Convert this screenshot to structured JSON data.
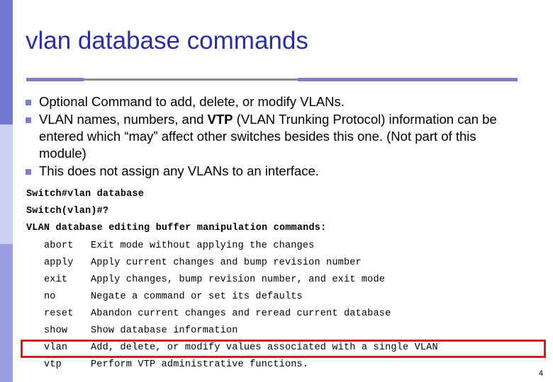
{
  "slide": {
    "title": "vlan database commands",
    "page_number": "4",
    "colors": {
      "title": "#2b2f9e",
      "bullet_marker": "#7b7fcc",
      "strip_top": "#7478d2",
      "strip_mid": "#cdd0f0",
      "strip_bottom": "#9a9de4",
      "divider_purple": "#7b7fc6",
      "divider_gray": "#8a8a93",
      "highlight_red": "#cc2027",
      "background": "#ffffff"
    }
  },
  "bullets": [
    {
      "marker": "square-bullet",
      "parts": [
        {
          "text": "Optional Command to add, delete, or modify VLANs.",
          "bold": false
        }
      ]
    },
    {
      "marker": "square-bullet",
      "parts": [
        {
          "text": "VLAN names, numbers, and ",
          "bold": false
        },
        {
          "text": "VTP",
          "bold": true
        },
        {
          "text": " (VLAN Trunking Protocol) information can be entered which “may” affect other switches besides this one.  (Not part of this module)",
          "bold": false
        }
      ]
    },
    {
      "marker": "square-bullet",
      "parts": [
        {
          "text": "This does not assign any VLANs to an interface.",
          "bold": false
        }
      ]
    }
  ],
  "console": {
    "lines": [
      "Switch#vlan database",
      "Switch(vlan)#?",
      "VLAN database editing buffer manipulation commands:"
    ]
  },
  "commands": [
    {
      "name": "abort",
      "description": "Exit mode without applying the changes",
      "highlighted": false
    },
    {
      "name": "apply",
      "description": "Apply current changes and bump revision number",
      "highlighted": false
    },
    {
      "name": "exit",
      "description": "Apply changes, bump revision number, and exit mode",
      "highlighted": false
    },
    {
      "name": "no",
      "description": "Negate a command or set its defaults",
      "highlighted": false
    },
    {
      "name": "reset",
      "description": "Abandon current changes and reread current database",
      "highlighted": false
    },
    {
      "name": "show",
      "description": "Show database information",
      "highlighted": false
    },
    {
      "name": "vlan",
      "description": "Add, delete, or modify values associated with a single VLAN",
      "highlighted": true
    },
    {
      "name": "vtp",
      "description": "Perform VTP administrative functions.",
      "highlighted": false
    }
  ]
}
